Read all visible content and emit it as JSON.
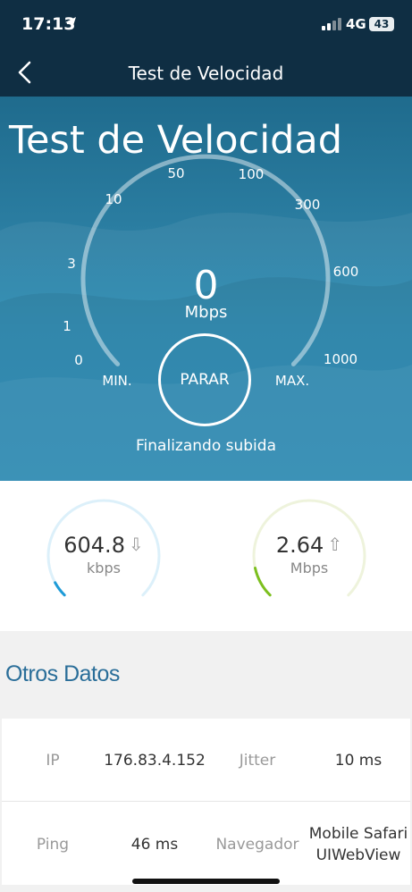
{
  "status": {
    "time": "17:13",
    "network": "4G",
    "battery": "43",
    "icons": [
      "location-arrow-icon",
      "signal-icon"
    ]
  },
  "nav": {
    "title": "Test de Velocidad",
    "back_icon": "chevron-left-icon"
  },
  "hero": {
    "title": "Test de Velocidad",
    "speed": "0",
    "unit": "Mbps",
    "min_label": "MIN.",
    "max_label": "MAX.",
    "stop_label": "PARAR",
    "phase": "Finalizando subida",
    "ticks": [
      "0",
      "1",
      "3",
      "10",
      "50",
      "100",
      "300",
      "600",
      "1000"
    ]
  },
  "results": {
    "download": {
      "value": "604.8",
      "unit": "kbps",
      "arrow": "⇩",
      "icon": "download-arrow-icon",
      "progress": 0.06,
      "color": "#1e9bd7",
      "track": "#dcf0fa"
    },
    "upload": {
      "value": "2.64",
      "unit": "Mbps",
      "arrow": "⇧",
      "icon": "upload-arrow-icon",
      "progress": 0.12,
      "color": "#7cbf1e",
      "track": "#eef3dc"
    }
  },
  "other": {
    "title": "Otros Datos",
    "rows": [
      {
        "label1": "IP",
        "value1": "176.83.4.152",
        "label2": "Jitter",
        "value2": "10 ms"
      },
      {
        "label1": "Ping",
        "value1": "46 ms",
        "label2": "Navegador",
        "value2": "Mobile Safari UIWebView"
      }
    ]
  }
}
